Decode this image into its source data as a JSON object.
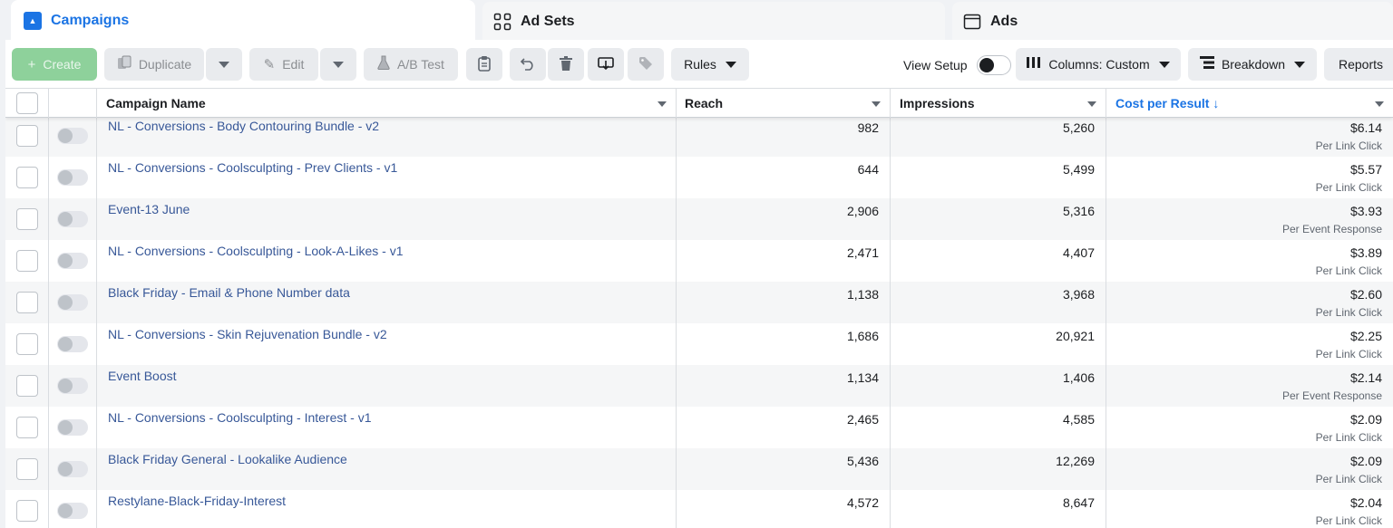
{
  "tabs": {
    "campaigns": "Campaigns",
    "adsets": "Ad Sets",
    "ads": "Ads"
  },
  "toolbar": {
    "create": "Create",
    "duplicate": "Duplicate",
    "edit": "Edit",
    "ab_test": "A/B Test",
    "rules": "Rules",
    "view_setup": "View Setup",
    "columns": "Columns: Custom",
    "breakdown": "Breakdown",
    "reports": "Reports"
  },
  "columns": {
    "name": "Campaign Name",
    "reach": "Reach",
    "impressions": "Impressions",
    "cost": "Cost per Result ↓"
  },
  "rows": [
    {
      "name": "NL - Conversions - Body Contouring Bundle - v2",
      "reach": "982",
      "impressions": "5,260",
      "cost": "$6.14",
      "cost_type": "Per Link Click"
    },
    {
      "name": "NL - Conversions - Coolsculpting - Prev Clients - v1",
      "reach": "644",
      "impressions": "5,499",
      "cost": "$5.57",
      "cost_type": "Per Link Click"
    },
    {
      "name": "Event-13 June",
      "reach": "2,906",
      "impressions": "5,316",
      "cost": "$3.93",
      "cost_type": "Per Event Response"
    },
    {
      "name": "NL - Conversions - Coolsculpting - Look-A-Likes - v1",
      "reach": "2,471",
      "impressions": "4,407",
      "cost": "$3.89",
      "cost_type": "Per Link Click"
    },
    {
      "name": "Black Friday - Email & Phone Number data",
      "reach": "1,138",
      "impressions": "3,968",
      "cost": "$2.60",
      "cost_type": "Per Link Click"
    },
    {
      "name": "NL - Conversions - Skin Rejuvenation Bundle - v2",
      "reach": "1,686",
      "impressions": "20,921",
      "cost": "$2.25",
      "cost_type": "Per Link Click"
    },
    {
      "name": "Event Boost",
      "reach": "1,134",
      "impressions": "1,406",
      "cost": "$2.14",
      "cost_type": "Per Event Response"
    },
    {
      "name": "NL - Conversions - Coolsculpting - Interest - v1",
      "reach": "2,465",
      "impressions": "4,585",
      "cost": "$2.09",
      "cost_type": "Per Link Click"
    },
    {
      "name": "Black Friday General - Lookalike Audience",
      "reach": "5,436",
      "impressions": "12,269",
      "cost": "$2.09",
      "cost_type": "Per Link Click"
    },
    {
      "name": "Restylane-Black-Friday-Interest",
      "reach": "4,572",
      "impressions": "8,647",
      "cost": "$2.04",
      "cost_type": "Per Link Click"
    }
  ]
}
